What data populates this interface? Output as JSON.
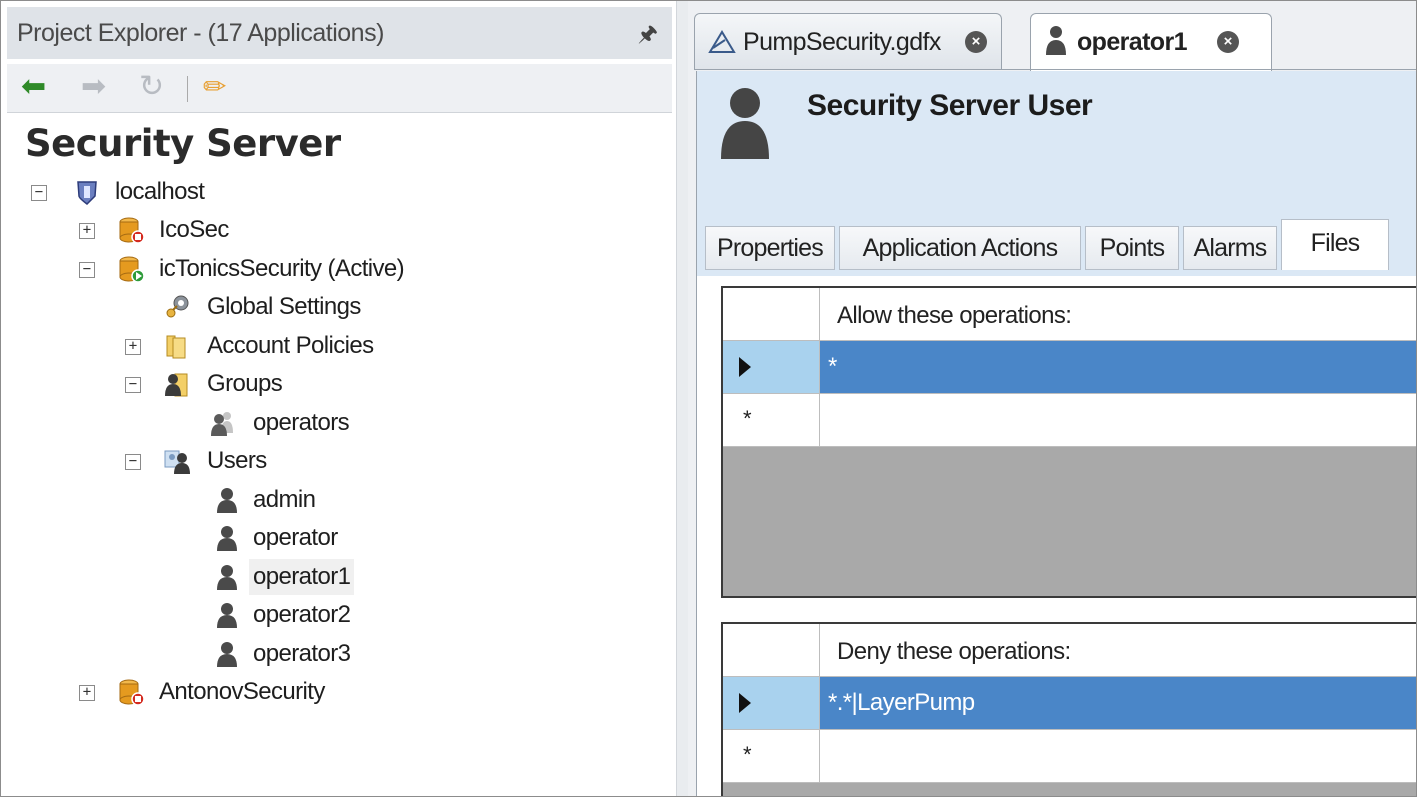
{
  "explorer": {
    "title": "Project Explorer - (17 Applications)",
    "pin_icon": "pin-icon",
    "toolbar": [
      "back-arrow-icon",
      "forward-arrow-icon",
      "refresh-icon",
      "edit-pencil-icon"
    ],
    "heading": "Security Server"
  },
  "tree": {
    "localhost": "localhost",
    "icosec": "IcoSec",
    "ictonics": "icTonicsSecurity (Active)",
    "global_settings": "Global Settings",
    "account_policies": "Account Policies",
    "groups": "Groups",
    "operators": "operators",
    "users": "Users",
    "admin": "admin",
    "operator": "operator",
    "operator1": "operator1",
    "operator2": "operator2",
    "operator3": "operator3",
    "antonov": "AntonovSecurity"
  },
  "doc_tabs": [
    {
      "label": "PumpSecurity.gdfx",
      "active": false
    },
    {
      "label": "operator1",
      "active": true
    }
  ],
  "editor": {
    "header_title": "Security Server User",
    "tabs": [
      "Properties",
      "Application Actions",
      "Points",
      "Alarms",
      "Files"
    ],
    "active_tab": "Files",
    "allow": {
      "header": "Allow these operations:",
      "rows": [
        "*"
      ],
      "new_row_marker": "*"
    },
    "deny": {
      "header": "Deny these operations:",
      "rows": [
        "*.*|LayerPump"
      ],
      "new_row_marker": "*"
    }
  },
  "colors": {
    "header_band": "#dbe8f5",
    "selection": "#4a86c8",
    "current_row_header": "#a9d2ee"
  }
}
